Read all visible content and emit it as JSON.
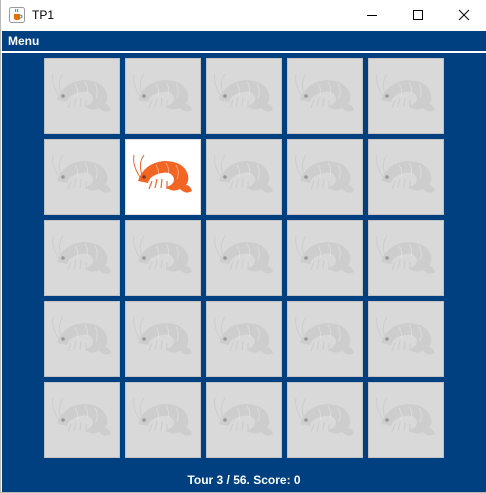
{
  "window": {
    "title": "TP1",
    "icon": "java-cup-icon",
    "controls": [
      "minimize-icon",
      "maximize-icon",
      "close-icon"
    ]
  },
  "menubar": {
    "items": [
      {
        "label": "Menu"
      }
    ]
  },
  "board": {
    "rows": 5,
    "cols": 5,
    "cards": [
      {
        "state": "hidden",
        "image": "shrimp-icon"
      },
      {
        "state": "hidden",
        "image": "shrimp-icon"
      },
      {
        "state": "hidden",
        "image": "shrimp-icon"
      },
      {
        "state": "hidden",
        "image": "shrimp-icon"
      },
      {
        "state": "hidden",
        "image": "shrimp-icon"
      },
      {
        "state": "hidden",
        "image": "shrimp-icon"
      },
      {
        "state": "revealed",
        "image": "shrimp-icon"
      },
      {
        "state": "hidden",
        "image": "shrimp-icon"
      },
      {
        "state": "hidden",
        "image": "shrimp-icon"
      },
      {
        "state": "hidden",
        "image": "shrimp-icon"
      },
      {
        "state": "hidden",
        "image": "shrimp-icon"
      },
      {
        "state": "hidden",
        "image": "shrimp-icon"
      },
      {
        "state": "hidden",
        "image": "shrimp-icon"
      },
      {
        "state": "hidden",
        "image": "shrimp-icon"
      },
      {
        "state": "hidden",
        "image": "shrimp-icon"
      },
      {
        "state": "hidden",
        "image": "shrimp-icon"
      },
      {
        "state": "hidden",
        "image": "shrimp-icon"
      },
      {
        "state": "hidden",
        "image": "shrimp-icon"
      },
      {
        "state": "hidden",
        "image": "shrimp-icon"
      },
      {
        "state": "hidden",
        "image": "shrimp-icon"
      },
      {
        "state": "hidden",
        "image": "shrimp-icon"
      },
      {
        "state": "hidden",
        "image": "shrimp-icon"
      },
      {
        "state": "hidden",
        "image": "shrimp-icon"
      },
      {
        "state": "hidden",
        "image": "shrimp-icon"
      },
      {
        "state": "hidden",
        "image": "shrimp-icon"
      }
    ]
  },
  "status": {
    "text": "Tour 3 / 56.  Score: 0"
  },
  "colors": {
    "board_background": "#003f80",
    "card_hidden": "#d9d9d9",
    "card_revealed": "#ffffff",
    "shrimp_revealed": "#f26522",
    "shrimp_hidden": "#c4c4c4"
  }
}
